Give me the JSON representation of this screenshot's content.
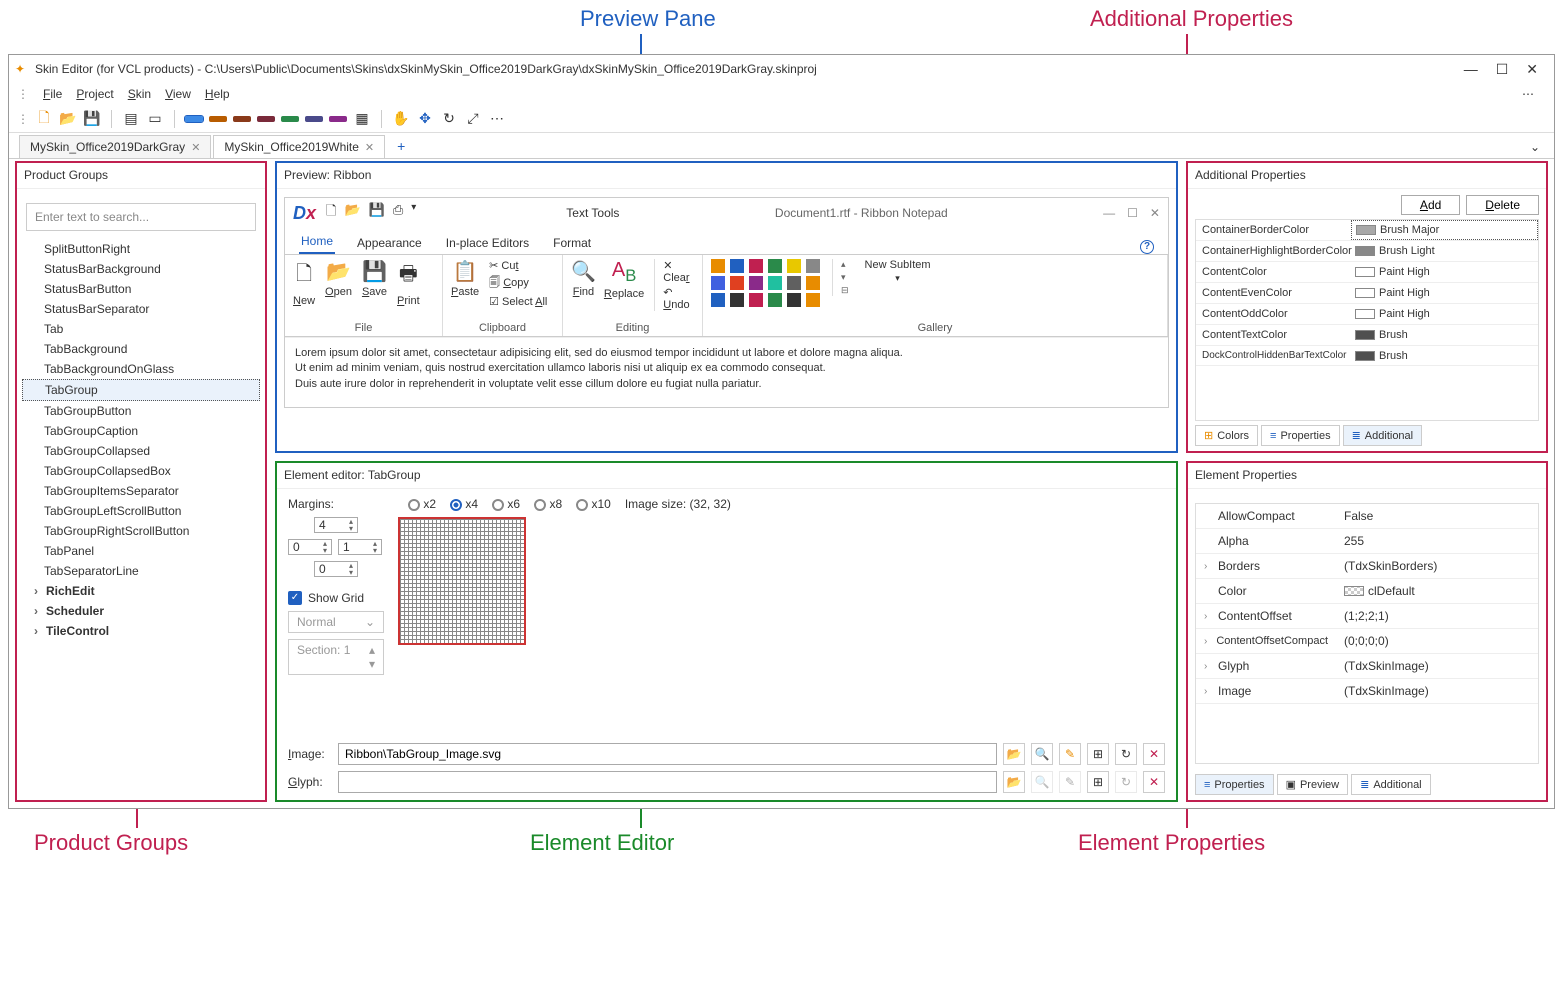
{
  "annotations": {
    "preview_pane": "Preview Pane",
    "additional_properties": "Additional Properties",
    "product_groups": "Product Groups",
    "element_editor": "Element Editor",
    "element_properties": "Element Properties"
  },
  "window": {
    "title": "Skin Editor (for VCL products) - C:\\Users\\Public\\Documents\\Skins\\dxSkinMySkin_Office2019DarkGray\\dxSkinMySkin_Office2019DarkGray.skinproj"
  },
  "menu": {
    "file": "File",
    "project": "Project",
    "skin": "Skin",
    "view": "View",
    "help": "Help"
  },
  "tabs": {
    "tab1": "MySkin_Office2019DarkGray",
    "tab2": "MySkin_Office2019White"
  },
  "product_groups": {
    "title": "Product Groups",
    "search_placeholder": "Enter text to search...",
    "items": [
      "SplitButtonRight",
      "StatusBarBackground",
      "StatusBarButton",
      "StatusBarSeparator",
      "Tab",
      "TabBackground",
      "TabBackgroundOnGlass",
      "TabGroup",
      "TabGroupButton",
      "TabGroupCaption",
      "TabGroupCollapsed",
      "TabGroupCollapsedBox",
      "TabGroupItemsSeparator",
      "TabGroupLeftScrollButton",
      "TabGroupRightScrollButton",
      "TabPanel",
      "TabSeparatorLine"
    ],
    "selected": "TabGroup",
    "parents": [
      "RichEdit",
      "Scheduler",
      "TileControl"
    ]
  },
  "preview": {
    "title": "Preview: Ribbon",
    "doc_title": "Document1.rtf - Ribbon Notepad",
    "context_tab": "Text Tools",
    "tabs": [
      "Home",
      "Appearance",
      "In-place Editors",
      "Format"
    ],
    "file_group": "File",
    "clipboard_group": "Clipboard",
    "editing_group": "Editing",
    "gallery_group": "Gallery",
    "btn_new": "New",
    "btn_open": "Open",
    "btn_save": "Save",
    "btn_print": "Print",
    "btn_paste": "Paste",
    "btn_cut": "Cut",
    "btn_copy": "Copy",
    "btn_selectall": "Select All",
    "btn_find": "Find",
    "btn_replace": "Replace",
    "btn_clear": "Clear",
    "btn_undo": "Undo",
    "btn_newsubitem": "New SubItem",
    "lorem": "Lorem ipsum dolor sit amet, consectetaur adipisicing elit, sed do eiusmod tempor incididunt ut labore et dolore magna aliqua.\nUt enim ad minim veniam, quis nostrud exercitation ullamco laboris nisi ut aliquip ex ea commodo consequat.\nDuis aute irure dolor in reprehenderit in voluptate velit esse cillum dolore eu fugiat nulla pariatur."
  },
  "additional": {
    "title": "Additional Properties",
    "add": "Add",
    "delete": "Delete",
    "rows": [
      {
        "key": "ContainerBorderColor",
        "val": "Brush Major",
        "color": "#a8a8a8"
      },
      {
        "key": "ContainerHighlightBorderColor",
        "val": "Brush Light",
        "color": "#888888"
      },
      {
        "key": "ContentColor",
        "val": "Paint High",
        "color": "#ffffff"
      },
      {
        "key": "ContentEvenColor",
        "val": "Paint High",
        "color": "#ffffff"
      },
      {
        "key": "ContentOddColor",
        "val": "Paint High",
        "color": "#ffffff"
      },
      {
        "key": "ContentTextColor",
        "val": "Brush",
        "color": "#505050"
      },
      {
        "key": "DockControlHiddenBarTextColor",
        "val": "Brush",
        "color": "#505050"
      }
    ],
    "tab_colors": "Colors",
    "tab_properties": "Properties",
    "tab_additional": "Additional"
  },
  "editor": {
    "title": "Element editor: TabGroup",
    "margins_label": "Margins:",
    "zoom_x2": "x2",
    "zoom_x4": "x4",
    "zoom_x6": "x6",
    "zoom_x8": "x8",
    "zoom_x10": "x10",
    "image_size": "Image size: (32, 32)",
    "margin_top": "4",
    "margin_left": "0",
    "margin_right": "1",
    "margin_bottom": "0",
    "show_grid": "Show Grid",
    "normal": "Normal",
    "section": "Section: 1",
    "image_label": "Image:",
    "image_path": "Ribbon\\TabGroup_Image.svg",
    "glyph_label": "Glyph:",
    "glyph_path": ""
  },
  "elprops": {
    "title": "Element Properties",
    "rows": [
      {
        "k": "AllowCompact",
        "v": "False",
        "exp": false
      },
      {
        "k": "Alpha",
        "v": "255",
        "exp": false
      },
      {
        "k": "Borders",
        "v": "(TdxSkinBorders)",
        "exp": true
      },
      {
        "k": "Color",
        "v": "clDefault",
        "exp": false,
        "sw": true
      },
      {
        "k": "ContentOffset",
        "v": "(1;2;2;1)",
        "exp": true
      },
      {
        "k": "ContentOffsetCompact",
        "v": "(0;0;0;0)",
        "exp": true
      },
      {
        "k": "Glyph",
        "v": "(TdxSkinImage)",
        "exp": true
      },
      {
        "k": "Image",
        "v": "(TdxSkinImage)",
        "exp": true
      }
    ],
    "tab_properties": "Properties",
    "tab_preview": "Preview",
    "tab_additional": "Additional"
  }
}
